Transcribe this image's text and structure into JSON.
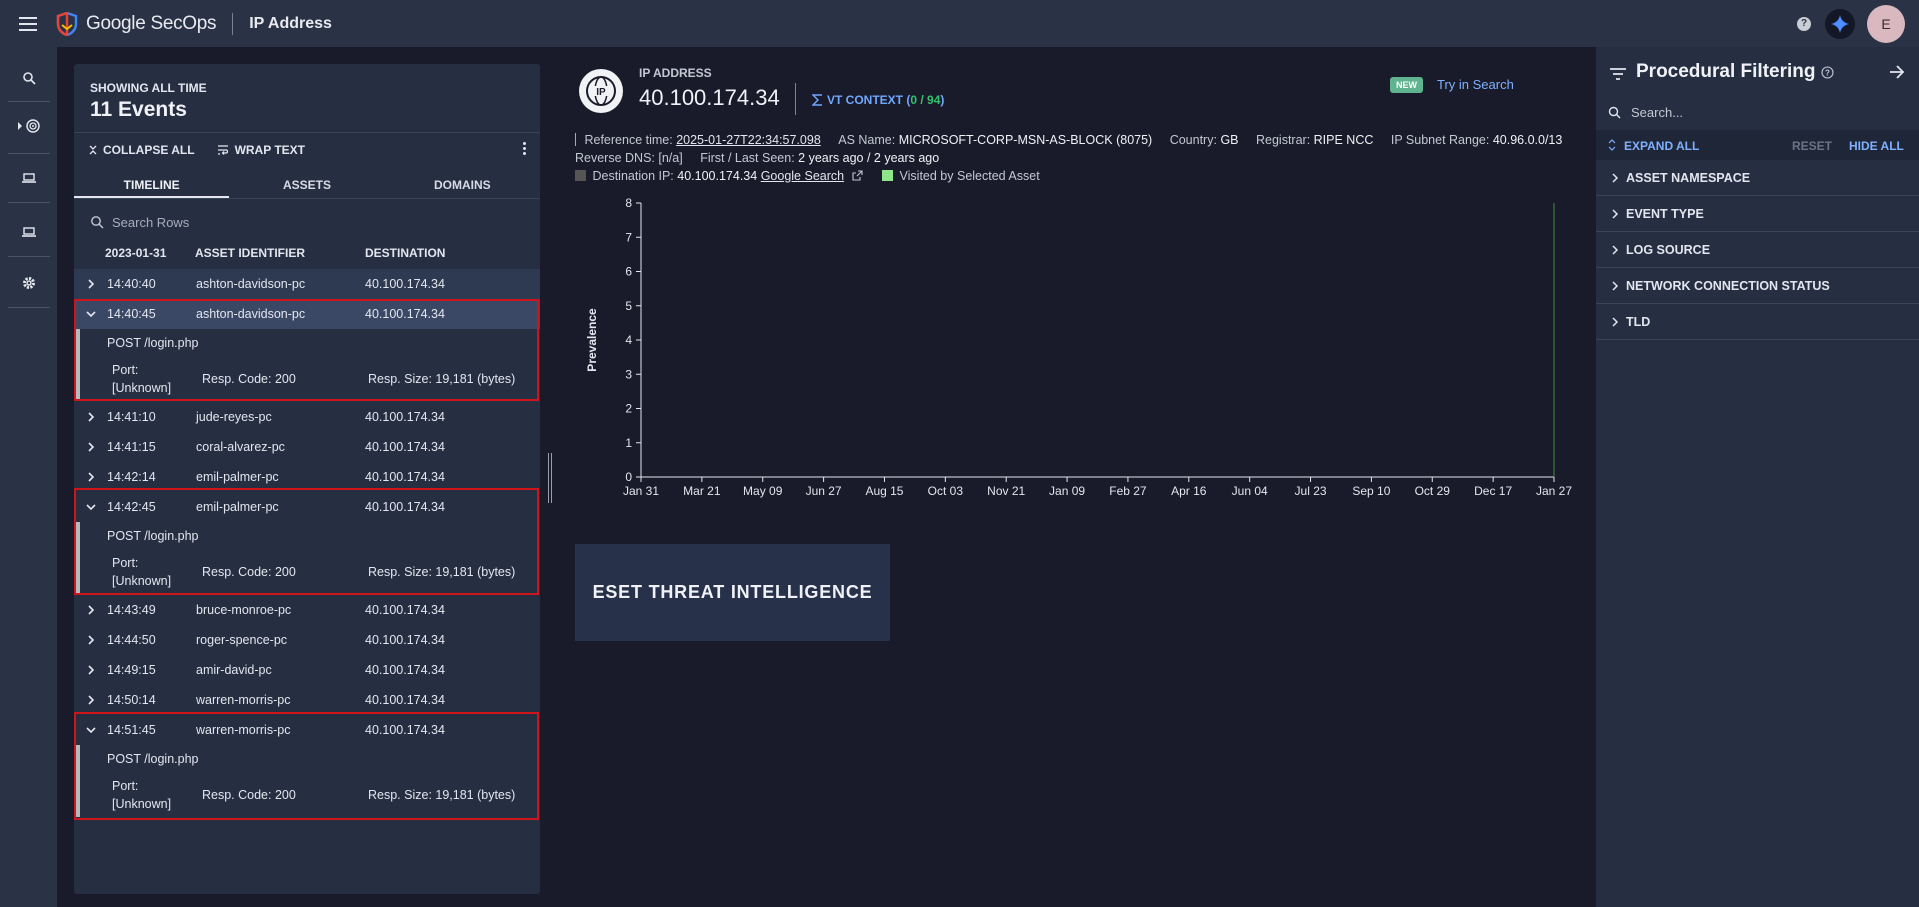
{
  "app": {
    "logo_text": "Google SecOps",
    "page_title": "IP Address",
    "user_initial": "E"
  },
  "events": {
    "showing_label": "SHOWING ALL TIME",
    "count_label": "11 Events",
    "collapse_all": "COLLAPSE ALL",
    "wrap_text": "WRAP TEXT",
    "tabs": [
      "TIMELINE",
      "ASSETS",
      "DOMAINS"
    ],
    "search_placeholder": "Search Rows",
    "columns": {
      "date": "2023-01-31",
      "asset": "ASSET IDENTIFIER",
      "destination": "DESTINATION"
    },
    "rows": [
      {
        "time": "14:40:40",
        "asset": "ashton-davidson-pc",
        "dest": "40.100.174.34"
      },
      {
        "time": "14:40:45",
        "asset": "ashton-davidson-pc",
        "dest": "40.100.174.34"
      },
      {
        "time": "14:41:10",
        "asset": "jude-reyes-pc",
        "dest": "40.100.174.34"
      },
      {
        "time": "14:41:15",
        "asset": "coral-alvarez-pc",
        "dest": "40.100.174.34"
      },
      {
        "time": "14:42:14",
        "asset": "emil-palmer-pc",
        "dest": "40.100.174.34"
      },
      {
        "time": "14:42:45",
        "asset": "emil-palmer-pc",
        "dest": "40.100.174.34"
      },
      {
        "time": "14:43:49",
        "asset": "bruce-monroe-pc",
        "dest": "40.100.174.34"
      },
      {
        "time": "14:44:50",
        "asset": "roger-spence-pc",
        "dest": "40.100.174.34"
      },
      {
        "time": "14:49:15",
        "asset": "amir-david-pc",
        "dest": "40.100.174.34"
      },
      {
        "time": "14:50:14",
        "asset": "warren-morris-pc",
        "dest": "40.100.174.34"
      },
      {
        "time": "14:51:45",
        "asset": "warren-morris-pc",
        "dest": "40.100.174.34"
      }
    ],
    "detail": {
      "request": "POST /login.php",
      "port_label": "Port:",
      "port_value": "[Unknown]",
      "resp_code": "Resp. Code: 200",
      "resp_size": "Resp. Size: 19,181 (bytes)"
    }
  },
  "ip": {
    "label": "IP ADDRESS",
    "value": "40.100.174.34",
    "icon_text": "IP",
    "vt_label": "VT CONTEXT (",
    "vt_score": "0 / 94",
    "vt_close": ")",
    "new_badge": "NEW",
    "try_search": "Try in Search",
    "ref_time_label": "Reference time:",
    "ref_time_value": "2025-01-27T22:34:57.098",
    "as_name_label": "AS Name:",
    "as_name_value": "MICROSOFT-CORP-MSN-AS-BLOCK (8075)",
    "country_label": "Country:",
    "country_value": "GB",
    "registrar_label": "Registrar:",
    "registrar_value": "RIPE NCC",
    "subnet_label": "IP Subnet Range:",
    "subnet_value": "40.96.0.0/13",
    "rdns_label": "Reverse DNS:",
    "rdns_value": "[n/a]",
    "seen_label": "First / Last Seen:",
    "seen_value": "2 years ago / 2 years ago",
    "dest_ip_label": "Destination IP:",
    "dest_ip_value": "40.100.174.34",
    "google_search": "Google Search",
    "visited_label": "Visited by Selected Asset"
  },
  "chart_data": {
    "type": "line",
    "ylabel": "Prevalence",
    "ylim": [
      0,
      8
    ],
    "yticks": [
      "0",
      "1",
      "2",
      "3",
      "4",
      "5",
      "6",
      "7",
      "8"
    ],
    "xticks": [
      "Jan 31",
      "Mar 21",
      "May 09",
      "Jun 27",
      "Aug 15",
      "Oct 03",
      "Nov 21",
      "Jan 09",
      "Feb 27",
      "Apr 16",
      "Jun 04",
      "Jul 23",
      "Sep 10",
      "Oct 29",
      "Dec 17",
      "Jan 27"
    ],
    "series": [],
    "colors": {
      "destination": "#555555",
      "visited": "#8fe68a",
      "axis": "#e3e6ee"
    }
  },
  "eset": {
    "title": "ESET THREAT INTELLIGENCE"
  },
  "filter": {
    "title": "Procedural Filtering",
    "search_placeholder": "Search...",
    "expand_all": "EXPAND ALL",
    "reset": "RESET",
    "hide_all": "HIDE ALL",
    "items": [
      "ASSET NAMESPACE",
      "EVENT TYPE",
      "LOG SOURCE",
      "NETWORK CONNECTION STATUS",
      "TLD"
    ]
  },
  "colors": {
    "accent": "#7fb0ff",
    "highlight_box": "#d0141b",
    "panel": "#262f42",
    "topbar": "#2a3345",
    "vt_green": "#32c36c"
  }
}
